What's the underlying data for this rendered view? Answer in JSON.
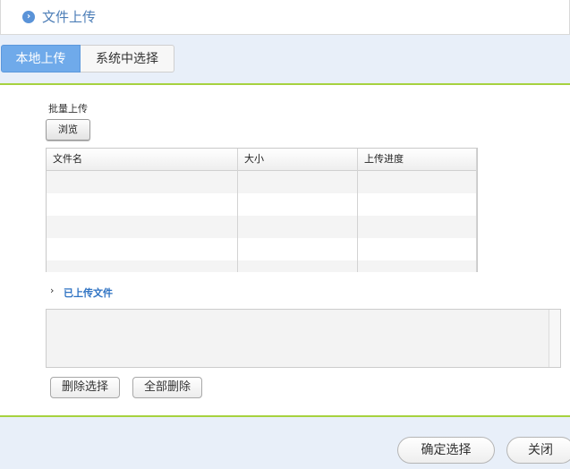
{
  "header": {
    "title": "文件上传",
    "icon": "chevron-circle-icon"
  },
  "tabs": [
    {
      "label": "本地上传",
      "active": true
    },
    {
      "label": "系统中选择",
      "active": false
    }
  ],
  "upload": {
    "batch_label": "批量上传",
    "browse_label": "浏览",
    "columns": [
      "文件名",
      "大小",
      "上传进度"
    ]
  },
  "uploaded": {
    "label": "已上传文件",
    "delete_selected_label": "删除选择",
    "delete_all_label": "全部删除"
  },
  "footer": {
    "confirm_label": "确定选择",
    "close_label": "关闭"
  },
  "colors": {
    "accent_blue": "#6faaea",
    "link_blue": "#2f73c3",
    "divider_green": "#a6d23f",
    "panel_bg": "#e8eff9"
  }
}
